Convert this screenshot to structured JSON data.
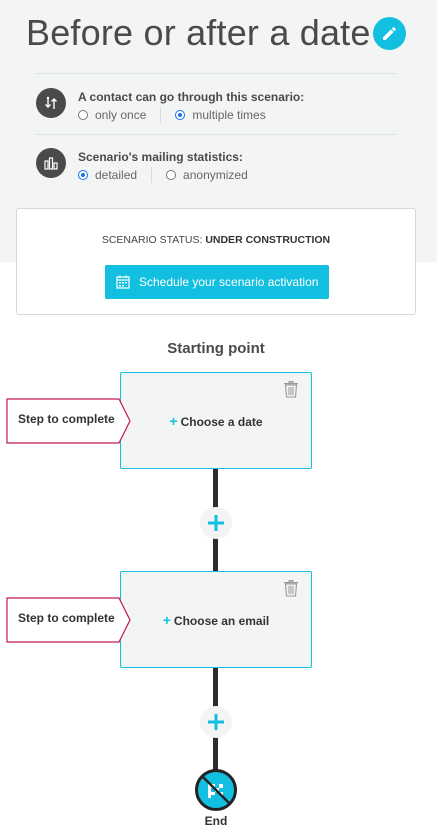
{
  "header": {
    "title": "Before or after a date"
  },
  "options": {
    "frequency": {
      "title": "A contact can go through this scenario:",
      "choices": [
        "only once",
        "multiple times"
      ],
      "selected": "multiple times"
    },
    "statistics": {
      "title": "Scenario's mailing statistics:",
      "choices": [
        "detailed",
        "anonymized"
      ],
      "selected": "detailed"
    }
  },
  "status": {
    "prefix": "SCENARIO STATUS:",
    "value": "UNDER CONSTRUCTION",
    "schedule_button": "Schedule your scenario activation"
  },
  "flow": {
    "start_label": "Starting point",
    "steps": [
      {
        "action": "Choose a date",
        "tag": "Step to complete"
      },
      {
        "action": "Choose an email",
        "tag": "Step to complete"
      }
    ],
    "end_label": "End"
  },
  "colors": {
    "accent": "#13bfe1",
    "dark": "#4a4a4a",
    "tag_border": "#c2185b"
  }
}
